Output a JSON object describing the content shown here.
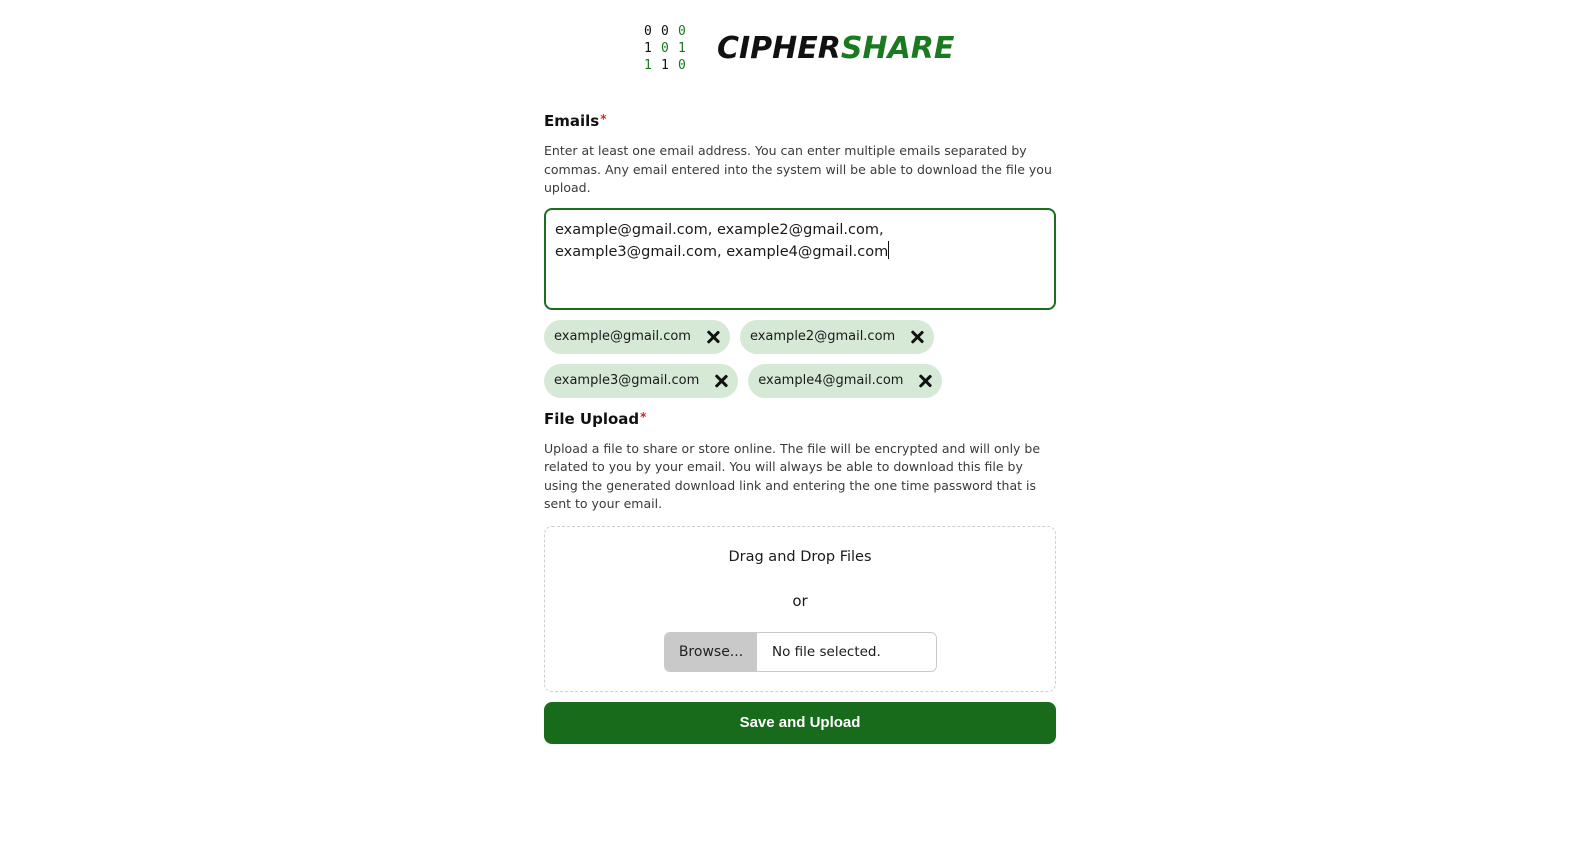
{
  "logo": {
    "binary": [
      {
        "d": "0",
        "color": "#111111"
      },
      {
        "d": "0",
        "color": "#111111"
      },
      {
        "d": "0",
        "color": "#1a7a1f"
      },
      {
        "d": "1",
        "color": "#111111"
      },
      {
        "d": "0",
        "color": "#1a7a1f"
      },
      {
        "d": "1",
        "color": "#1a7a1f"
      },
      {
        "d": "1",
        "color": "#1a7a1f"
      },
      {
        "d": "1",
        "color": "#111111"
      },
      {
        "d": "0",
        "color": "#1a7a1f"
      }
    ],
    "part1": "CIPHER",
    "part2": "SHARE",
    "accent_color": "#1a7a1f"
  },
  "emails": {
    "label": "Emails",
    "required_mark": "*",
    "help": "Enter at least one email address. You can enter multiple emails separated by commas. Any email entered into the system will be able to download the file you upload.",
    "value": "example@gmail.com, example2@gmail.com, example3@gmail.com, example4@gmail.com",
    "chips": [
      "example@gmail.com",
      "example2@gmail.com",
      "example3@gmail.com",
      "example4@gmail.com"
    ]
  },
  "upload": {
    "label": "File Upload",
    "required_mark": "*",
    "help": "Upload a file to share or store online. The file will be encrypted and will only be related to you by your email. You will always be able to download this file by using the generated download link and entering the one time password that is sent to your email.",
    "drop_title": "Drag and Drop Files",
    "or": "or",
    "browse_label": "Browse...",
    "file_status": "No file selected."
  },
  "submit_label": "Save and Upload",
  "colors": {
    "primary": "#176b1b",
    "chip_bg": "#d6e8d6",
    "required": "#dd2222"
  }
}
